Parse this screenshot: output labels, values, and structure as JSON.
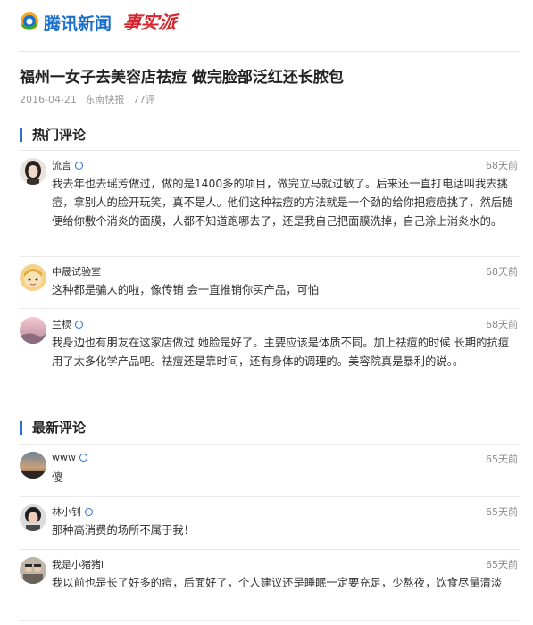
{
  "brand": {
    "logo_text": "腾讯新闻",
    "sub_logo": "事实派",
    "colors": {
      "logo_blue": "#1a6fc9",
      "sub_logo_red": "#d6262d",
      "accent": "#2a6fd1"
    }
  },
  "article": {
    "title": "福州一女子去美容店祛痘 做完脸部泛红还长脓包",
    "date": "2016-04-21",
    "source": "东南快报",
    "comment_count": "77评"
  },
  "hot_section": {
    "title": "热门评论",
    "comments": [
      {
        "name": "流言",
        "verified": true,
        "time": "68天前",
        "avatar": "avatar-woman-dark-hair",
        "text": "我去年也去瑶芳做过，做的是1400多的项目，做完立马就过敏了。后来还一直打电话叫我去挑痘，拿别人的脸开玩笑，真不是人。他们这种祛痘的方法就是一个劲的给你把痘痘挑了，然后随便给你敷个消炎的面膜，人都不知道跑哪去了，还是我自己把面膜洗掉，自己涂上消炎水的。"
      },
      {
        "name": "中晟试验室",
        "verified": false,
        "time": "68天前",
        "avatar": "avatar-cartoon-girl",
        "text": "这种都是骗人的啦，像传销 会一直推销你买产品，可怕"
      },
      {
        "name": "兰棂",
        "verified": true,
        "time": "68天前",
        "avatar": "avatar-landscape-pink",
        "text": "我身边也有朋友在这家店做过 她脸是好了。主要应该是体质不同。加上祛痘的时候 长期的抗痘用了太多化学产品吧。祛痘还是靠时间，还有身体的调理的。美容院真是暴利的说。。"
      }
    ]
  },
  "new_section": {
    "title": "最新评论",
    "comments": [
      {
        "name": "www",
        "verified": true,
        "time": "65天前",
        "avatar": "avatar-sunset",
        "text": "傻"
      },
      {
        "name": "林小钊",
        "verified": true,
        "time": "65天前",
        "avatar": "avatar-person-portrait",
        "text": "那种高消费的场所不属于我！"
      },
      {
        "name": "我是小猪猪i",
        "verified": false,
        "time": "65天前",
        "avatar": "avatar-group-photo",
        "text": "我以前也是长了好多的痘，后面好了，个人建议还是睡眠一定要充足，少熬夜，饮食尽量清淡"
      }
    ]
  }
}
